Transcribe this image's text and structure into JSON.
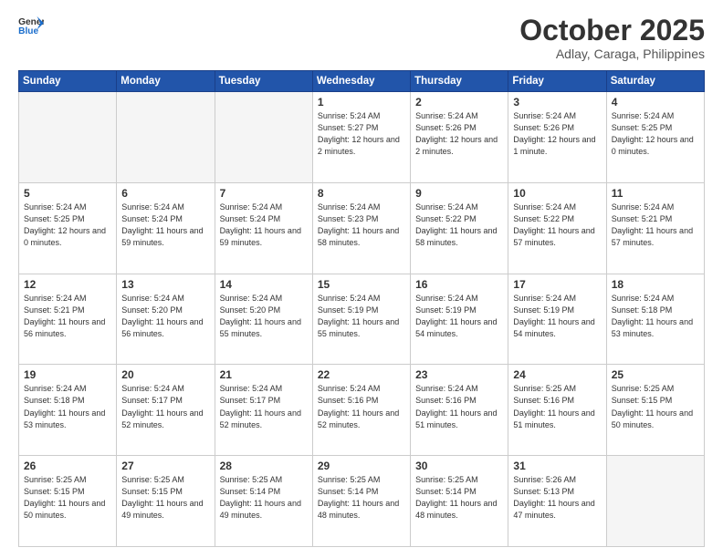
{
  "header": {
    "logo_line1": "General",
    "logo_line2": "Blue",
    "month": "October 2025",
    "location": "Adlay, Caraga, Philippines"
  },
  "days_of_week": [
    "Sunday",
    "Monday",
    "Tuesday",
    "Wednesday",
    "Thursday",
    "Friday",
    "Saturday"
  ],
  "weeks": [
    [
      {
        "day": "",
        "empty": true
      },
      {
        "day": "",
        "empty": true
      },
      {
        "day": "",
        "empty": true
      },
      {
        "day": "1",
        "sunrise": "5:24 AM",
        "sunset": "5:27 PM",
        "daylight": "12 hours and 2 minutes."
      },
      {
        "day": "2",
        "sunrise": "5:24 AM",
        "sunset": "5:26 PM",
        "daylight": "12 hours and 2 minutes."
      },
      {
        "day": "3",
        "sunrise": "5:24 AM",
        "sunset": "5:26 PM",
        "daylight": "12 hours and 1 minute."
      },
      {
        "day": "4",
        "sunrise": "5:24 AM",
        "sunset": "5:25 PM",
        "daylight": "12 hours and 0 minutes."
      }
    ],
    [
      {
        "day": "5",
        "sunrise": "5:24 AM",
        "sunset": "5:25 PM",
        "daylight": "12 hours and 0 minutes."
      },
      {
        "day": "6",
        "sunrise": "5:24 AM",
        "sunset": "5:24 PM",
        "daylight": "11 hours and 59 minutes."
      },
      {
        "day": "7",
        "sunrise": "5:24 AM",
        "sunset": "5:24 PM",
        "daylight": "11 hours and 59 minutes."
      },
      {
        "day": "8",
        "sunrise": "5:24 AM",
        "sunset": "5:23 PM",
        "daylight": "11 hours and 58 minutes."
      },
      {
        "day": "9",
        "sunrise": "5:24 AM",
        "sunset": "5:22 PM",
        "daylight": "11 hours and 58 minutes."
      },
      {
        "day": "10",
        "sunrise": "5:24 AM",
        "sunset": "5:22 PM",
        "daylight": "11 hours and 57 minutes."
      },
      {
        "day": "11",
        "sunrise": "5:24 AM",
        "sunset": "5:21 PM",
        "daylight": "11 hours and 57 minutes."
      }
    ],
    [
      {
        "day": "12",
        "sunrise": "5:24 AM",
        "sunset": "5:21 PM",
        "daylight": "11 hours and 56 minutes."
      },
      {
        "day": "13",
        "sunrise": "5:24 AM",
        "sunset": "5:20 PM",
        "daylight": "11 hours and 56 minutes."
      },
      {
        "day": "14",
        "sunrise": "5:24 AM",
        "sunset": "5:20 PM",
        "daylight": "11 hours and 55 minutes."
      },
      {
        "day": "15",
        "sunrise": "5:24 AM",
        "sunset": "5:19 PM",
        "daylight": "11 hours and 55 minutes."
      },
      {
        "day": "16",
        "sunrise": "5:24 AM",
        "sunset": "5:19 PM",
        "daylight": "11 hours and 54 minutes."
      },
      {
        "day": "17",
        "sunrise": "5:24 AM",
        "sunset": "5:19 PM",
        "daylight": "11 hours and 54 minutes."
      },
      {
        "day": "18",
        "sunrise": "5:24 AM",
        "sunset": "5:18 PM",
        "daylight": "11 hours and 53 minutes."
      }
    ],
    [
      {
        "day": "19",
        "sunrise": "5:24 AM",
        "sunset": "5:18 PM",
        "daylight": "11 hours and 53 minutes."
      },
      {
        "day": "20",
        "sunrise": "5:24 AM",
        "sunset": "5:17 PM",
        "daylight": "11 hours and 52 minutes."
      },
      {
        "day": "21",
        "sunrise": "5:24 AM",
        "sunset": "5:17 PM",
        "daylight": "11 hours and 52 minutes."
      },
      {
        "day": "22",
        "sunrise": "5:24 AM",
        "sunset": "5:16 PM",
        "daylight": "11 hours and 52 minutes."
      },
      {
        "day": "23",
        "sunrise": "5:24 AM",
        "sunset": "5:16 PM",
        "daylight": "11 hours and 51 minutes."
      },
      {
        "day": "24",
        "sunrise": "5:25 AM",
        "sunset": "5:16 PM",
        "daylight": "11 hours and 51 minutes."
      },
      {
        "day": "25",
        "sunrise": "5:25 AM",
        "sunset": "5:15 PM",
        "daylight": "11 hours and 50 minutes."
      }
    ],
    [
      {
        "day": "26",
        "sunrise": "5:25 AM",
        "sunset": "5:15 PM",
        "daylight": "11 hours and 50 minutes."
      },
      {
        "day": "27",
        "sunrise": "5:25 AM",
        "sunset": "5:15 PM",
        "daylight": "11 hours and 49 minutes."
      },
      {
        "day": "28",
        "sunrise": "5:25 AM",
        "sunset": "5:14 PM",
        "daylight": "11 hours and 49 minutes."
      },
      {
        "day": "29",
        "sunrise": "5:25 AM",
        "sunset": "5:14 PM",
        "daylight": "11 hours and 48 minutes."
      },
      {
        "day": "30",
        "sunrise": "5:25 AM",
        "sunset": "5:14 PM",
        "daylight": "11 hours and 48 minutes."
      },
      {
        "day": "31",
        "sunrise": "5:26 AM",
        "sunset": "5:13 PM",
        "daylight": "11 hours and 47 minutes."
      },
      {
        "day": "",
        "empty": true
      }
    ]
  ]
}
